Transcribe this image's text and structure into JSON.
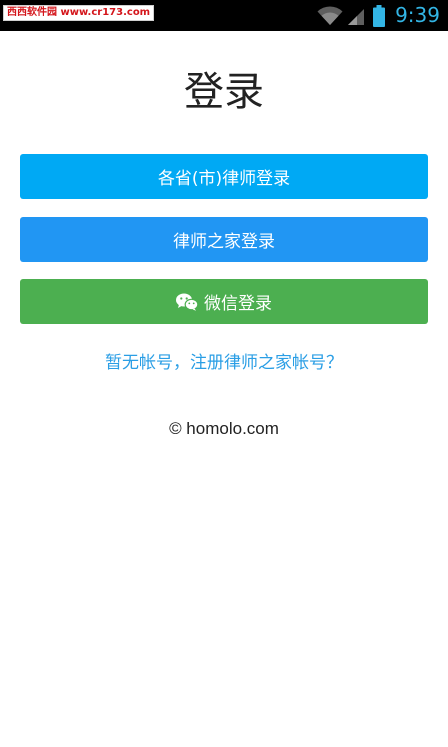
{
  "status_bar": {
    "watermark": "西西软件园 www.cr173.com",
    "time": "9:39",
    "icons": [
      "wifi-icon",
      "cell-signal-icon",
      "battery-icon"
    ],
    "clock_color": "#33b5e5"
  },
  "page": {
    "title": "登录"
  },
  "buttons": {
    "province_login": {
      "label": "各省(市)律师登录",
      "color": "#00a9f4"
    },
    "lawyer_home_login": {
      "label": "律师之家登录",
      "color": "#2196f3"
    },
    "wechat_login": {
      "label": "微信登录",
      "icon": "wechat-icon",
      "color": "#4caf50"
    }
  },
  "register_link": "暂无帐号，注册律师之家帐号？",
  "footer": {
    "copyright": "© homolo.com"
  }
}
